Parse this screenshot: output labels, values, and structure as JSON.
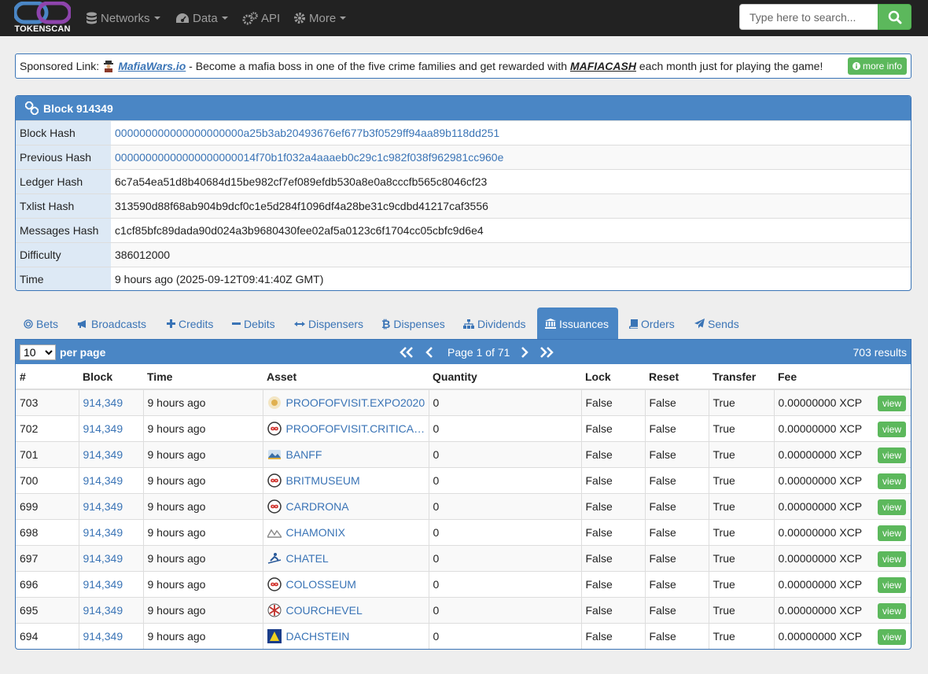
{
  "brand": {
    "name": "TOKENSCAN"
  },
  "nav": {
    "networks": "Networks",
    "data": "Data",
    "api": "API",
    "more": "More"
  },
  "search": {
    "placeholder": "Type here to search..."
  },
  "sponsor": {
    "prefix": "Sponsored Link:",
    "site": "MafiaWars.io",
    "middle": " - Become a mafia boss in one of the five crime families and get rewarded with ",
    "token": "MAFIACASH",
    "suffix": " each month just for playing the game!",
    "more_info": "more info"
  },
  "block": {
    "title": "Block 914349",
    "rows": [
      {
        "key": "Block Hash",
        "value": "000000000000000000000a25b3ab20493676ef677b3f0529ff94aa89b118dd251",
        "link": true
      },
      {
        "key": "Previous Hash",
        "value": "00000000000000000000014f70b1f032a4aaaeb0c29c1c982f038f962981cc960e",
        "link": true
      },
      {
        "key": "Ledger Hash",
        "value": "6c7a54ea51d8b40684d15be982cf7ef089efdb530a8e0a8cccfb565c8046cf23",
        "link": false
      },
      {
        "key": "Txlist Hash",
        "value": "313590d88f68ab904b9dcf0c1e5d284f1096df4a28be31c9cdbd41217caf3556",
        "link": false
      },
      {
        "key": "Messages Hash",
        "value": "c1cf85bfc89dada90d024a3b9680430fee02af5a0123c6f1704cc05cbfc9d6e4",
        "link": false
      },
      {
        "key": "Difficulty",
        "value": "386012000",
        "link": false
      },
      {
        "key": "Time",
        "value": "9 hours ago (2025-09-12T09:41:40Z GMT)",
        "link": false
      }
    ]
  },
  "tabs": [
    {
      "label": "Bets",
      "icon": "bullseye-icon"
    },
    {
      "label": "Broadcasts",
      "icon": "bullhorn-icon"
    },
    {
      "label": "Credits",
      "icon": "plus-icon"
    },
    {
      "label": "Debits",
      "icon": "minus-icon"
    },
    {
      "label": "Dispensers",
      "icon": "arrows-h-icon"
    },
    {
      "label": "Dispenses",
      "icon": "bitcoin-icon"
    },
    {
      "label": "Dividends",
      "icon": "sitemap-icon"
    },
    {
      "label": "Issuances",
      "icon": "bank-icon",
      "active": true
    },
    {
      "label": "Orders",
      "icon": "book-icon"
    },
    {
      "label": "Sends",
      "icon": "send-icon"
    }
  ],
  "table_bar": {
    "per_page_value": "10",
    "per_page_label": "per page",
    "page_text": "Page 1 of 71",
    "results": "703 results"
  },
  "columns": [
    "#",
    "Block",
    "Time",
    "Asset",
    "Quantity",
    "Lock",
    "Reset",
    "Transfer",
    "Fee"
  ],
  "rows": [
    {
      "num": "703",
      "block": "914,349",
      "time": "9 hours ago",
      "asset": "PROOFOFVISIT.EXPO2020",
      "icon": "sun-badge-icon",
      "qty": "0",
      "lock": "False",
      "reset": "False",
      "transfer": "True",
      "fee": "0.00000000 XCP",
      "view": "view"
    },
    {
      "num": "702",
      "block": "914,349",
      "time": "9 hours ago",
      "asset": "PROOFOFVISIT.CRITICA…",
      "icon": "infinity-token-icon",
      "qty": "0",
      "lock": "False",
      "reset": "False",
      "transfer": "True",
      "fee": "0.00000000 XCP",
      "view": "view"
    },
    {
      "num": "701",
      "block": "914,349",
      "time": "9 hours ago",
      "asset": "BANFF",
      "icon": "landscape-icon",
      "qty": "0",
      "lock": "False",
      "reset": "False",
      "transfer": "True",
      "fee": "0.00000000 XCP",
      "view": "view"
    },
    {
      "num": "700",
      "block": "914,349",
      "time": "9 hours ago",
      "asset": "BRITMUSEUM",
      "icon": "infinity-token-icon",
      "qty": "0",
      "lock": "False",
      "reset": "False",
      "transfer": "True",
      "fee": "0.00000000 XCP",
      "view": "view"
    },
    {
      "num": "699",
      "block": "914,349",
      "time": "9 hours ago",
      "asset": "CARDRONA",
      "icon": "infinity-token-icon",
      "qty": "0",
      "lock": "False",
      "reset": "False",
      "transfer": "True",
      "fee": "0.00000000 XCP",
      "view": "view"
    },
    {
      "num": "698",
      "block": "914,349",
      "time": "9 hours ago",
      "asset": "CHAMONIX",
      "icon": "mountains-icon",
      "qty": "0",
      "lock": "False",
      "reset": "False",
      "transfer": "True",
      "fee": "0.00000000 XCP",
      "view": "view"
    },
    {
      "num": "697",
      "block": "914,349",
      "time": "9 hours ago",
      "asset": "CHATEL",
      "icon": "skier-icon",
      "qty": "0",
      "lock": "False",
      "reset": "False",
      "transfer": "True",
      "fee": "0.00000000 XCP",
      "view": "view"
    },
    {
      "num": "696",
      "block": "914,349",
      "time": "9 hours ago",
      "asset": "COLOSSEUM",
      "icon": "infinity-token-icon",
      "qty": "0",
      "lock": "False",
      "reset": "False",
      "transfer": "True",
      "fee": "0.00000000 XCP",
      "view": "view"
    },
    {
      "num": "695",
      "block": "914,349",
      "time": "9 hours ago",
      "asset": "COURCHEVEL",
      "icon": "snowflake-badge-icon",
      "qty": "0",
      "lock": "False",
      "reset": "False",
      "transfer": "True",
      "fee": "0.00000000 XCP",
      "view": "view"
    },
    {
      "num": "694",
      "block": "914,349",
      "time": "9 hours ago",
      "asset": "DACHSTEIN",
      "icon": "triangle-badge-icon",
      "qty": "0",
      "lock": "False",
      "reset": "False",
      "transfer": "True",
      "fee": "0.00000000 XCP",
      "view": "view"
    }
  ],
  "colors": {
    "navbar": "#222222",
    "panel_header": "#4a86c5",
    "link": "#3a74b6",
    "success": "#5cb85c"
  }
}
